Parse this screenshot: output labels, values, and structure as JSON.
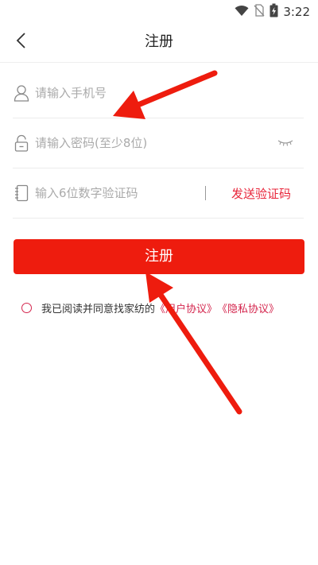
{
  "status_bar": {
    "time": "3:22",
    "icons": [
      "wifi-icon",
      "no-sim-icon",
      "battery-charging-icon"
    ]
  },
  "header": {
    "title": "注册",
    "back_icon": "chevron-left-icon"
  },
  "form": {
    "phone": {
      "placeholder": "请输入手机号",
      "value": "",
      "icon": "user-icon"
    },
    "password": {
      "placeholder": "请输入密码(至少8位)",
      "value": "",
      "icon": "lock-icon",
      "toggle_icon": "eye-closed-icon"
    },
    "code": {
      "placeholder": "输入6位数字验证码",
      "value": "",
      "icon": "notebook-icon",
      "send_label": "发送验证码"
    }
  },
  "register_button": {
    "label": "注册"
  },
  "agreement": {
    "text": "我已阅读并同意找家纺的",
    "user_agreement": "《用户协议》",
    "privacy_policy": "《隐私协议》"
  },
  "colors": {
    "accent_red": "#ee1c0e",
    "link_red": "#d4254d",
    "annotation_arrow": "#ee1c0e"
  },
  "annotations": [
    "arrow-pointing-to-phone-field",
    "arrow-pointing-to-register-button"
  ]
}
